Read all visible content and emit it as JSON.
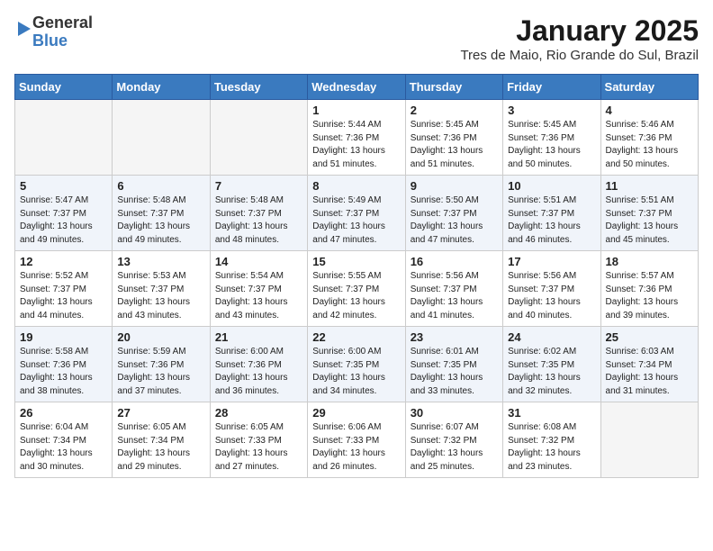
{
  "header": {
    "logo_general": "General",
    "logo_blue": "Blue",
    "title": "January 2025",
    "subtitle": "Tres de Maio, Rio Grande do Sul, Brazil"
  },
  "weekdays": [
    "Sunday",
    "Monday",
    "Tuesday",
    "Wednesday",
    "Thursday",
    "Friday",
    "Saturday"
  ],
  "weeks": [
    [
      {
        "day": "",
        "info": ""
      },
      {
        "day": "",
        "info": ""
      },
      {
        "day": "",
        "info": ""
      },
      {
        "day": "1",
        "info": "Sunrise: 5:44 AM\nSunset: 7:36 PM\nDaylight: 13 hours\nand 51 minutes."
      },
      {
        "day": "2",
        "info": "Sunrise: 5:45 AM\nSunset: 7:36 PM\nDaylight: 13 hours\nand 51 minutes."
      },
      {
        "day": "3",
        "info": "Sunrise: 5:45 AM\nSunset: 7:36 PM\nDaylight: 13 hours\nand 50 minutes."
      },
      {
        "day": "4",
        "info": "Sunrise: 5:46 AM\nSunset: 7:36 PM\nDaylight: 13 hours\nand 50 minutes."
      }
    ],
    [
      {
        "day": "5",
        "info": "Sunrise: 5:47 AM\nSunset: 7:37 PM\nDaylight: 13 hours\nand 49 minutes."
      },
      {
        "day": "6",
        "info": "Sunrise: 5:48 AM\nSunset: 7:37 PM\nDaylight: 13 hours\nand 49 minutes."
      },
      {
        "day": "7",
        "info": "Sunrise: 5:48 AM\nSunset: 7:37 PM\nDaylight: 13 hours\nand 48 minutes."
      },
      {
        "day": "8",
        "info": "Sunrise: 5:49 AM\nSunset: 7:37 PM\nDaylight: 13 hours\nand 47 minutes."
      },
      {
        "day": "9",
        "info": "Sunrise: 5:50 AM\nSunset: 7:37 PM\nDaylight: 13 hours\nand 47 minutes."
      },
      {
        "day": "10",
        "info": "Sunrise: 5:51 AM\nSunset: 7:37 PM\nDaylight: 13 hours\nand 46 minutes."
      },
      {
        "day": "11",
        "info": "Sunrise: 5:51 AM\nSunset: 7:37 PM\nDaylight: 13 hours\nand 45 minutes."
      }
    ],
    [
      {
        "day": "12",
        "info": "Sunrise: 5:52 AM\nSunset: 7:37 PM\nDaylight: 13 hours\nand 44 minutes."
      },
      {
        "day": "13",
        "info": "Sunrise: 5:53 AM\nSunset: 7:37 PM\nDaylight: 13 hours\nand 43 minutes."
      },
      {
        "day": "14",
        "info": "Sunrise: 5:54 AM\nSunset: 7:37 PM\nDaylight: 13 hours\nand 43 minutes."
      },
      {
        "day": "15",
        "info": "Sunrise: 5:55 AM\nSunset: 7:37 PM\nDaylight: 13 hours\nand 42 minutes."
      },
      {
        "day": "16",
        "info": "Sunrise: 5:56 AM\nSunset: 7:37 PM\nDaylight: 13 hours\nand 41 minutes."
      },
      {
        "day": "17",
        "info": "Sunrise: 5:56 AM\nSunset: 7:37 PM\nDaylight: 13 hours\nand 40 minutes."
      },
      {
        "day": "18",
        "info": "Sunrise: 5:57 AM\nSunset: 7:36 PM\nDaylight: 13 hours\nand 39 minutes."
      }
    ],
    [
      {
        "day": "19",
        "info": "Sunrise: 5:58 AM\nSunset: 7:36 PM\nDaylight: 13 hours\nand 38 minutes."
      },
      {
        "day": "20",
        "info": "Sunrise: 5:59 AM\nSunset: 7:36 PM\nDaylight: 13 hours\nand 37 minutes."
      },
      {
        "day": "21",
        "info": "Sunrise: 6:00 AM\nSunset: 7:36 PM\nDaylight: 13 hours\nand 36 minutes."
      },
      {
        "day": "22",
        "info": "Sunrise: 6:00 AM\nSunset: 7:35 PM\nDaylight: 13 hours\nand 34 minutes."
      },
      {
        "day": "23",
        "info": "Sunrise: 6:01 AM\nSunset: 7:35 PM\nDaylight: 13 hours\nand 33 minutes."
      },
      {
        "day": "24",
        "info": "Sunrise: 6:02 AM\nSunset: 7:35 PM\nDaylight: 13 hours\nand 32 minutes."
      },
      {
        "day": "25",
        "info": "Sunrise: 6:03 AM\nSunset: 7:34 PM\nDaylight: 13 hours\nand 31 minutes."
      }
    ],
    [
      {
        "day": "26",
        "info": "Sunrise: 6:04 AM\nSunset: 7:34 PM\nDaylight: 13 hours\nand 30 minutes."
      },
      {
        "day": "27",
        "info": "Sunrise: 6:05 AM\nSunset: 7:34 PM\nDaylight: 13 hours\nand 29 minutes."
      },
      {
        "day": "28",
        "info": "Sunrise: 6:05 AM\nSunset: 7:33 PM\nDaylight: 13 hours\nand 27 minutes."
      },
      {
        "day": "29",
        "info": "Sunrise: 6:06 AM\nSunset: 7:33 PM\nDaylight: 13 hours\nand 26 minutes."
      },
      {
        "day": "30",
        "info": "Sunrise: 6:07 AM\nSunset: 7:32 PM\nDaylight: 13 hours\nand 25 minutes."
      },
      {
        "day": "31",
        "info": "Sunrise: 6:08 AM\nSunset: 7:32 PM\nDaylight: 13 hours\nand 23 minutes."
      },
      {
        "day": "",
        "info": ""
      }
    ]
  ]
}
